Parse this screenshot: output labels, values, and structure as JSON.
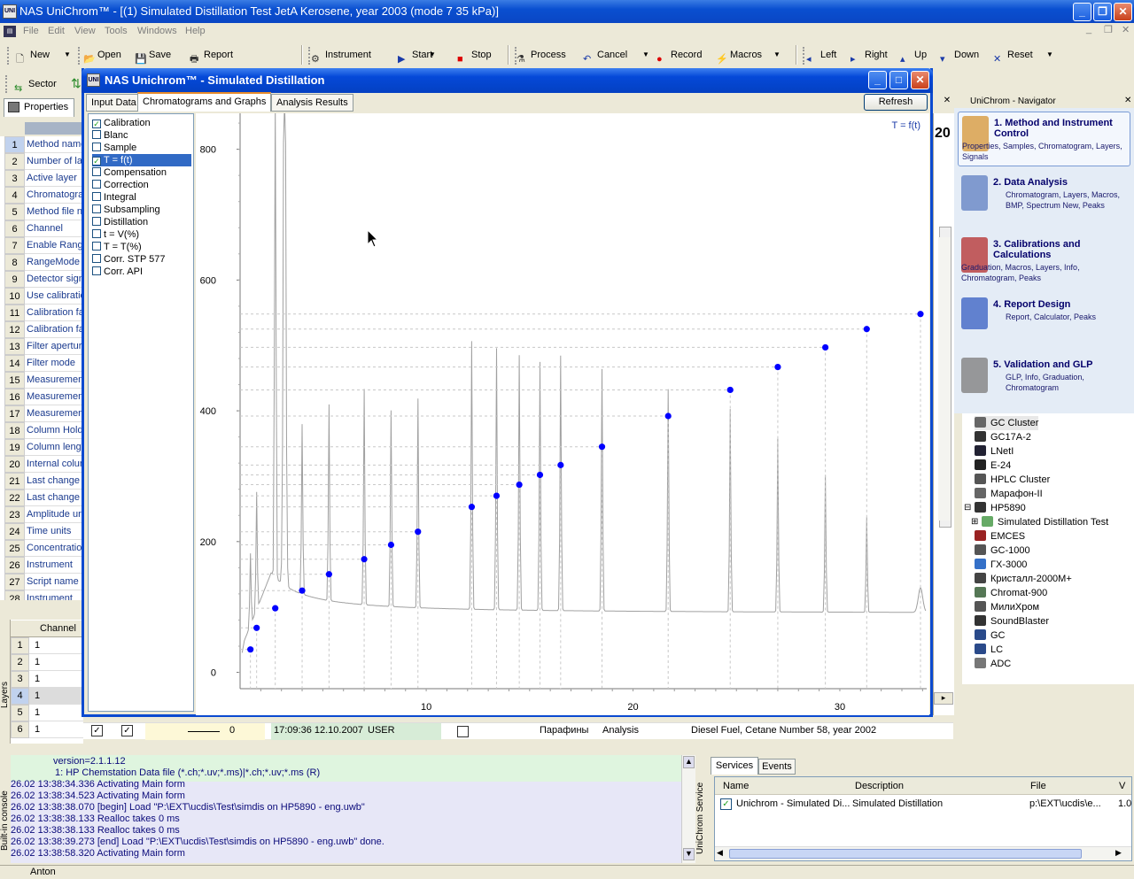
{
  "app": {
    "title": "NAS UniChrom™ - [(1) Simulated Distillation Test JetA Kerosene, year 2003 (mode 7 35 kPa)]",
    "icon_label": "UNI"
  },
  "menu": [
    "File",
    "Edit",
    "View",
    "Tools",
    "Windows",
    "Help"
  ],
  "toolbar1": [
    {
      "label": "New",
      "icon": "new-doc-icon",
      "glyph": "🗋"
    },
    {
      "label": "Open",
      "icon": "open-folder-icon",
      "glyph": "📂"
    },
    {
      "label": "Save",
      "icon": "save-disk-icon",
      "glyph": "💾"
    },
    {
      "label": "Report",
      "icon": "printer-icon",
      "glyph": "🖶"
    },
    {
      "label": "Instrument",
      "icon": "instrument-icon",
      "glyph": "⚙"
    },
    {
      "label": "Start",
      "icon": "play-icon",
      "glyph": "▶"
    },
    {
      "label": "Stop",
      "icon": "stop-icon",
      "glyph": "■"
    },
    {
      "label": "Process",
      "icon": "process-icon",
      "glyph": "⚗"
    },
    {
      "label": "Cancel",
      "icon": "undo-icon",
      "glyph": "↶"
    },
    {
      "label": "Record",
      "icon": "record-icon",
      "glyph": "●"
    },
    {
      "label": "Macros",
      "icon": "macros-icon",
      "glyph": "⚡"
    },
    {
      "label": "Left",
      "icon": "arrow-left-icon",
      "glyph": "◂"
    },
    {
      "label": "Right",
      "icon": "arrow-right-icon",
      "glyph": "▸"
    },
    {
      "label": "Up",
      "icon": "arrow-up-icon",
      "glyph": "▴"
    },
    {
      "label": "Down",
      "icon": "arrow-down-icon",
      "glyph": "▾"
    },
    {
      "label": "Reset",
      "icon": "reset-icon",
      "glyph": "✕"
    }
  ],
  "toolbar2": {
    "sector": "Sector"
  },
  "properties_tab": "Properties",
  "properties": [
    "Method name",
    "Number of la",
    "Active layer",
    "Chromatogra",
    "Method file n",
    "Channel",
    "Enable Rang",
    "RangeMode",
    "Detector sign",
    "Use calibratio",
    "Calibration fa",
    "Calibration fa",
    "Filter apertur",
    "Filter mode",
    "Measuremen",
    "Measuremen",
    "Measuremen",
    "Column Holde",
    "Column lengt",
    "Internal colur",
    "Last change",
    "Last change",
    "Amplitude ur",
    "Time units",
    "Concentratio",
    "Instrument",
    "Script name",
    "Instrument"
  ],
  "dialog": {
    "title": "NAS Unichrom™ - Simulated Distillation",
    "tabs": [
      "Input Data",
      "Chromatograms and Graphs",
      "Analysis Results"
    ],
    "refresh": "Refresh",
    "graph_options": [
      {
        "label": "Calibration",
        "checked": true
      },
      {
        "label": "Blanc",
        "checked": false
      },
      {
        "label": "Sample",
        "checked": false
      },
      {
        "label": "T = f(t)",
        "checked": true,
        "selected": true
      },
      {
        "label": "Compensation",
        "checked": false
      },
      {
        "label": "Correction",
        "checked": false
      },
      {
        "label": "Integral",
        "checked": false
      },
      {
        "label": "Subsampling",
        "checked": false
      },
      {
        "label": "Distillation",
        "checked": false
      },
      {
        "label": "t = V(%)",
        "checked": false
      },
      {
        "label": "T = T(%)",
        "checked": false
      },
      {
        "label": "Corr. STP 577",
        "checked": false
      },
      {
        "label": "Corr. API",
        "checked": false
      }
    ],
    "nav_arrows": [
      "⇦",
      "⇨"
    ]
  },
  "chart_data": {
    "type": "scatter",
    "legend": "T = f(t)",
    "xticks": [
      10,
      20,
      30
    ],
    "yticks": [
      0,
      200,
      400,
      600,
      800
    ],
    "xlim": [
      1,
      34.2
    ],
    "ylim": [
      -25,
      855
    ],
    "points": [
      {
        "x": 1.5,
        "y": 35
      },
      {
        "x": 1.8,
        "y": 68
      },
      {
        "x": 2.7,
        "y": 98
      },
      {
        "x": 4.0,
        "y": 125
      },
      {
        "x": 5.3,
        "y": 150
      },
      {
        "x": 7.0,
        "y": 173
      },
      {
        "x": 8.3,
        "y": 195
      },
      {
        "x": 9.6,
        "y": 215
      },
      {
        "x": 12.2,
        "y": 253
      },
      {
        "x": 13.4,
        "y": 270
      },
      {
        "x": 14.5,
        "y": 287
      },
      {
        "x": 15.5,
        "y": 302
      },
      {
        "x": 16.5,
        "y": 317
      },
      {
        "x": 18.5,
        "y": 345
      },
      {
        "x": 21.7,
        "y": 392
      },
      {
        "x": 24.7,
        "y": 432
      },
      {
        "x": 27.0,
        "y": 467
      },
      {
        "x": 29.3,
        "y": 497
      },
      {
        "x": 31.3,
        "y": 525
      },
      {
        "x": 33.9,
        "y": 548
      }
    ],
    "colors": {
      "points": "#0000ff",
      "trace": "#a0a0a0",
      "grid": "#c8c8c8"
    }
  },
  "navigator": {
    "title": "UniChrom - Navigator",
    "items": [
      {
        "title": "1. Method and Instrument Control",
        "sub": "Properties, Samples, Chromatogram, Layers, Signals"
      },
      {
        "title": "2. Data Analysis",
        "sub": "Chromatogram, Layers, Macros, BMP, Spectrum New, Peaks"
      },
      {
        "title": "3. Calibrations and Calculations",
        "sub": "Graduation, Macros, Layers, Info, Chromatogram, Peaks"
      },
      {
        "title": "4. Report Design",
        "sub": "Report, Calculator, Peaks"
      },
      {
        "title": "5. Validation and GLP",
        "sub": "GLP, Info, Graduation, Chromatogram"
      }
    ]
  },
  "tree": [
    {
      "label": "GC Cluster",
      "indent": 0
    },
    {
      "label": "GC17A-2",
      "indent": 0
    },
    {
      "label": "LNetI",
      "indent": 0
    },
    {
      "label": "E-24",
      "indent": 0
    },
    {
      "label": "HPLC Cluster",
      "indent": 0
    },
    {
      "label": "Марафон-II",
      "indent": 0
    },
    {
      "label": "HP5890",
      "indent": 0,
      "expander": "⊟"
    },
    {
      "label": "Simulated Distillation Test",
      "indent": 1,
      "expander": "⊞"
    },
    {
      "label": "EMCES",
      "indent": 0
    },
    {
      "label": "GC-1000",
      "indent": 0
    },
    {
      "label": "ГХ-3000",
      "indent": 0
    },
    {
      "label": "Кристалл-2000М+",
      "indent": 0
    },
    {
      "label": "Chromat-900",
      "indent": 0
    },
    {
      "label": "МилиХром",
      "indent": 0
    },
    {
      "label": "SoundBlaster",
      "indent": 0
    },
    {
      "label": "GC",
      "indent": 0
    },
    {
      "label": "LC",
      "indent": 0
    },
    {
      "label": "ADC",
      "indent": 0
    }
  ],
  "channels": {
    "header": "Channel",
    "rows": [
      "1",
      "1",
      "1",
      "1",
      "1",
      "1"
    ],
    "side_label": "Layers",
    "last_row": {
      "value": "0",
      "time": "17:09:36 12.10.2007",
      "user": "USER",
      "compound": "Парафины",
      "kind": "Analysis",
      "desc": "Diesel Fuel, Cetane Number 58, year 2002"
    }
  },
  "right_partial_text": "20",
  "console": {
    "side_label": "Built-in console",
    "lines": [
      "version=2.1.1.12",
      "1: HP Chemstation Data file (*.ch;*.uv;*.ms)|*.ch;*.uv;*.ms (R)",
      "26.02 13:38:34.336 Activating Main form",
      "26.02 13:38:34.523 Activating Main form",
      "26.02 13:38:38.070 [begin] Load \"P:\\EXT\\ucdis\\Test\\simdis on HP5890 - eng.uwb\"",
      "26.02 13:38:38.133 Realloc takes 0 ms",
      "26.02 13:38:38.133 Realloc takes 0 ms",
      "26.02 13:38:39.273 [end] Load \"P:\\EXT\\ucdis\\Test\\simdis on HP5890 - eng.uwb\" done.",
      "26.02 13:38:58.320 Activating Main form"
    ]
  },
  "services": {
    "side_label": "UniChrom Service",
    "tabs": [
      "Services",
      "Events"
    ],
    "columns": [
      "Name",
      "Description",
      "File",
      "V"
    ],
    "rows": [
      {
        "name": "Unichrom - Simulated Di...",
        "desc": "Simulated Distillation",
        "file": "p:\\EXT\\ucdis\\e...",
        "v": "1.0"
      }
    ]
  },
  "status": "Anton"
}
